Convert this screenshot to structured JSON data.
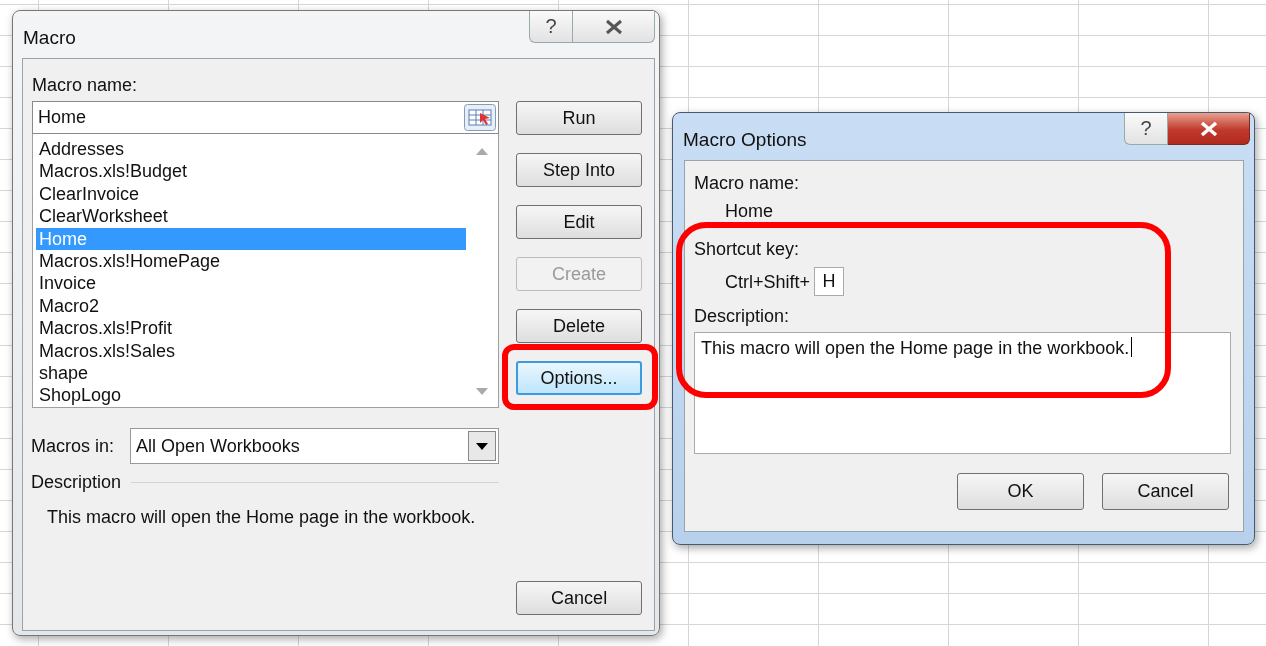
{
  "macro_dialog": {
    "title": "Macro",
    "help_button": "?",
    "macro_name": {
      "label": "Macro name:",
      "value": "Home"
    },
    "macros": [
      {
        "name": "Addresses",
        "selected": false
      },
      {
        "name": "Macros.xls!Budget",
        "selected": false
      },
      {
        "name": "ClearInvoice",
        "selected": false
      },
      {
        "name": "ClearWorksheet",
        "selected": false
      },
      {
        "name": "Home",
        "selected": true
      },
      {
        "name": "Macros.xls!HomePage",
        "selected": false
      },
      {
        "name": "Invoice",
        "selected": false
      },
      {
        "name": "Macro2",
        "selected": false
      },
      {
        "name": "Macros.xls!Profit",
        "selected": false
      },
      {
        "name": "Macros.xls!Sales",
        "selected": false
      },
      {
        "name": "shape",
        "selected": false
      },
      {
        "name": "ShopLogo",
        "selected": false
      }
    ],
    "buttons": [
      {
        "label": "Run",
        "disabled": false,
        "focused": false
      },
      {
        "label": "Step Into",
        "disabled": false,
        "focused": false
      },
      {
        "label": "Edit",
        "disabled": false,
        "focused": false
      },
      {
        "label": "Create",
        "disabled": true,
        "focused": false
      },
      {
        "label": "Delete",
        "disabled": false,
        "focused": false
      },
      {
        "label": "Options...",
        "disabled": false,
        "focused": true
      }
    ],
    "cancel_button": "Cancel",
    "macros_in": {
      "label": "Macros in:",
      "value": "All Open Workbooks"
    },
    "description": {
      "heading": "Description",
      "text": "This macro will open the Home page in the workbook."
    }
  },
  "options_dialog": {
    "title": "Macro Options",
    "help_button": "?",
    "macro_name_label": "Macro name:",
    "macro_name": "Home",
    "shortcut_label": "Shortcut key:",
    "shortcut_prefix": "Ctrl+Shift+",
    "shortcut_key": "H",
    "description_label": "Description:",
    "description": "This macro will open the Home page in the workbook.",
    "buttons": [
      "OK",
      "Cancel"
    ]
  }
}
